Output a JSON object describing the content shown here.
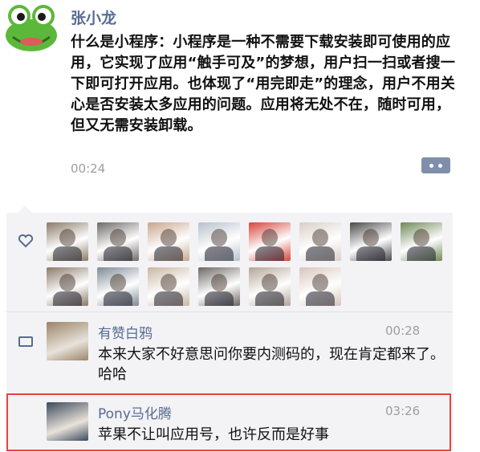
{
  "post": {
    "author": "张小龙",
    "text": "什么是小程序：小程序是一种不需要下载安装即可使用的应用，它实现了应用“触手可及”的梦想，用户扫一扫或者搜一下即可打开应用。也体现了“用完即走”的理念，用户不用关心是否安装太多应用的问题。应用将无处不在，随时可用，但又无需安装卸载。",
    "time": "00:24"
  },
  "likes": {
    "icon": "heart-icon",
    "avatars": [
      {
        "name": "avatar-1",
        "color": "#8a7a66"
      },
      {
        "name": "avatar-2",
        "color": "#6d6a68"
      },
      {
        "name": "avatar-3",
        "color": "#c9a68b"
      },
      {
        "name": "avatar-4",
        "color": "#b7c1cc"
      },
      {
        "name": "avatar-5",
        "color": "#d6453a"
      },
      {
        "name": "avatar-6",
        "color": "#d8cfc8"
      },
      {
        "name": "avatar-7",
        "color": "#4a4a4a"
      },
      {
        "name": "avatar-8",
        "color": "#6f8a57"
      },
      {
        "name": "avatar-9",
        "color": "#8b7968"
      },
      {
        "name": "avatar-10",
        "color": "#7e8a95"
      },
      {
        "name": "avatar-11",
        "color": "#c9b7a3"
      },
      {
        "name": "avatar-12",
        "color": "#6a6763"
      },
      {
        "name": "avatar-13",
        "color": "#b3a597"
      },
      {
        "name": "avatar-14",
        "color": "#d8c5bc"
      }
    ]
  },
  "comments": [
    {
      "name": "有赞白鸦",
      "time": "00:28",
      "text": "本来大家不好意思问你要内测码的，现在肯定都来了。哈哈",
      "avatar_color": "#9c8468"
    },
    {
      "name": "Pony马化腾",
      "time": "03:26",
      "text": "苹果不让叫应用号，也许反而是好事",
      "avatar_color": "#3d4a5c"
    }
  ],
  "colors": {
    "link": "#576b95",
    "highlight": "#e8433b",
    "panel": "#f3f3f5"
  }
}
